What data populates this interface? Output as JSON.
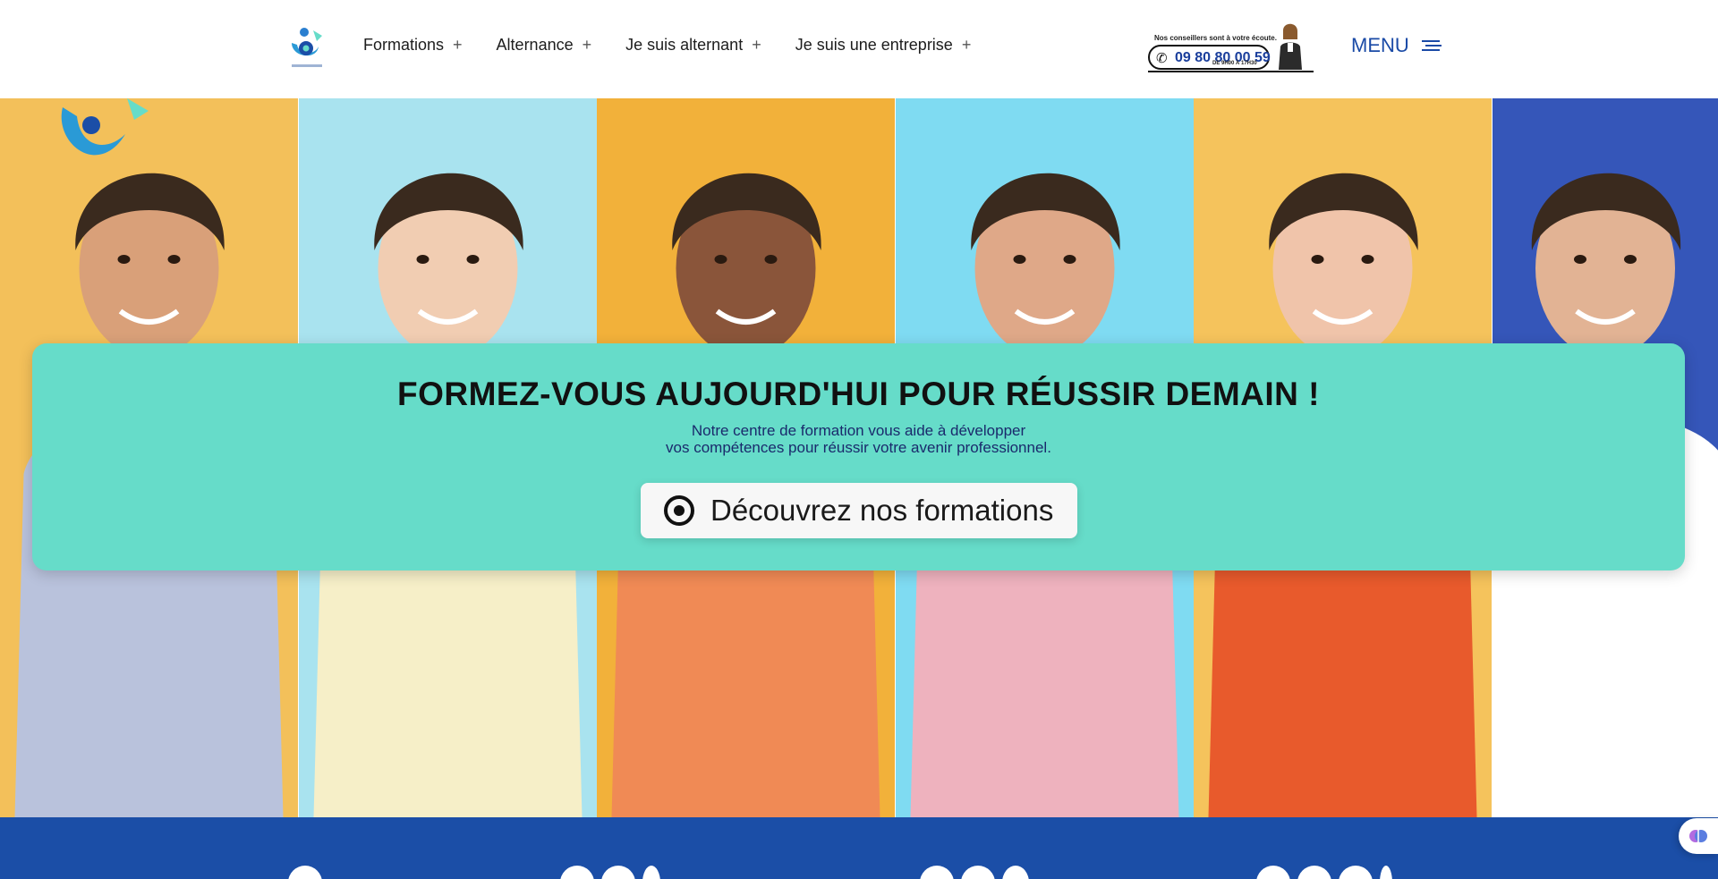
{
  "header": {
    "nav": [
      {
        "label": "Formations"
      },
      {
        "label": "Alternance"
      },
      {
        "label": "Je suis alternant"
      },
      {
        "label": "Je suis une entreprise"
      }
    ],
    "phone_banner": {
      "tagline": "Nos conseillers sont à votre écoute.",
      "number": "09 80 80 00 59",
      "hours": "DE 9H00 À 17H30"
    },
    "menu_label": "MENU"
  },
  "hero": {
    "title": "FORMEZ-VOUS AUJOURD'HUI POUR RÉUSSIR DEMAIN !",
    "subtitle_line1": "Notre centre de formation vous aide à développer",
    "subtitle_line2": "vos compétences pour réussir votre avenir professionnel.",
    "cta_label": "Découvrez nos formations",
    "tiles": [
      {
        "bg": "#f3c05a",
        "skin": "#d9a079",
        "shirt": "#b9c2dc"
      },
      {
        "bg": "#a9e3ef",
        "skin": "#f1cdb2",
        "shirt": "#f6efc8"
      },
      {
        "bg": "#f2b13a",
        "skin": "#8a553a",
        "shirt": "#f08a55"
      },
      {
        "bg": "#7fdbf2",
        "skin": "#dfa888",
        "shirt": "#eeb2be"
      },
      {
        "bg": "#f5c35c",
        "skin": "#f0c4aa",
        "shirt": "#e85a2c"
      },
      {
        "bg": "#3556b9",
        "skin": "#e2b394",
        "shirt": "#ffffff"
      }
    ]
  },
  "colors": {
    "accent": "#66dcc9",
    "brand_blue": "#1b4ea7",
    "menu_blue": "#1a4aa6"
  },
  "icons": {
    "cta": "target-icon",
    "menu": "hamburger-icon",
    "floating": "accessibility-brain-icon"
  }
}
